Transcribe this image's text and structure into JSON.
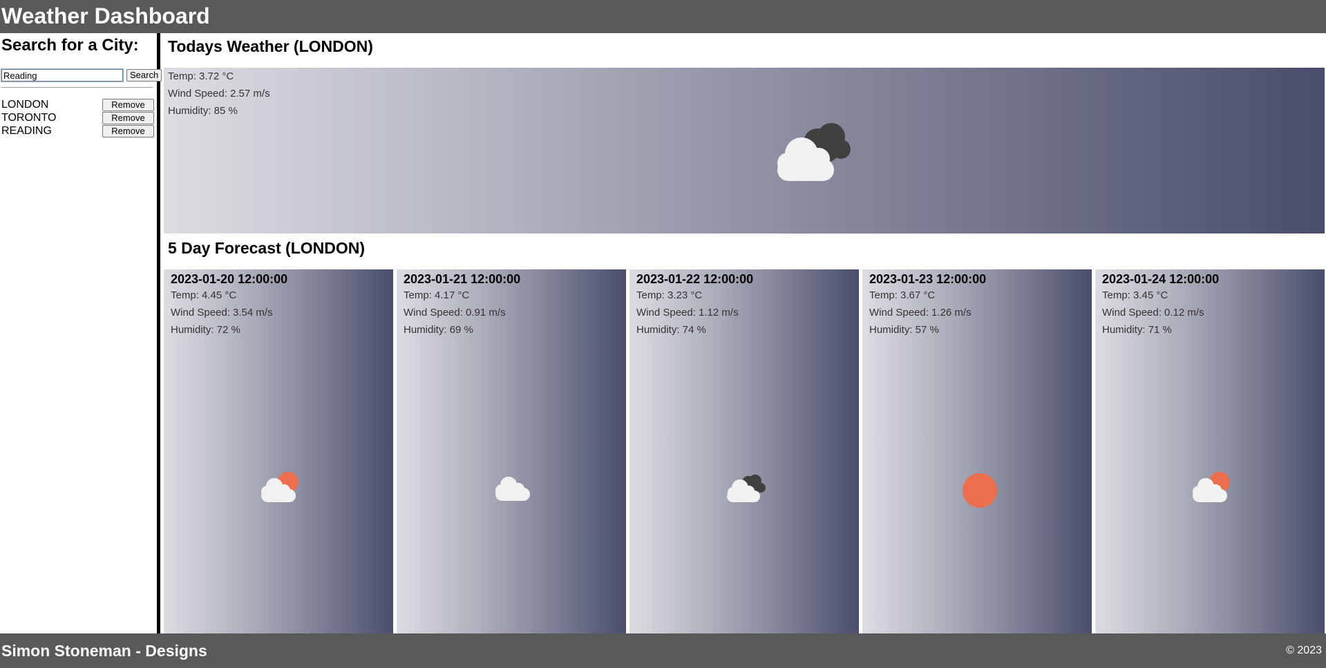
{
  "header": {
    "title": "Weather Dashboard"
  },
  "sidebar": {
    "heading": "Search for a City:",
    "search_value": "Reading",
    "search_button": "Search",
    "cities": [
      {
        "name": "LONDON",
        "remove_label": "Remove"
      },
      {
        "name": "TORONTO",
        "remove_label": "Remove"
      },
      {
        "name": "READING",
        "remove_label": "Remove"
      }
    ]
  },
  "today": {
    "title": "Todays Weather (LONDON)",
    "temp": "Temp: 3.72 °C",
    "wind": "Wind Speed: 2.57 m/s",
    "humidity": "Humidity: 85 %",
    "icon": "broken-clouds-icon"
  },
  "forecast": {
    "title": "5 Day Forecast (LONDON)",
    "days": [
      {
        "date": "2023-01-20 12:00:00",
        "temp": "Temp: 4.45 °C",
        "wind": "Wind Speed: 3.54 m/s",
        "humidity": "Humidity: 72 %",
        "icon": "partly-cloudy-icon"
      },
      {
        "date": "2023-01-21 12:00:00",
        "temp": "Temp: 4.17 °C",
        "wind": "Wind Speed: 0.91 m/s",
        "humidity": "Humidity: 69 %",
        "icon": "cloud-icon"
      },
      {
        "date": "2023-01-22 12:00:00",
        "temp": "Temp: 3.23 °C",
        "wind": "Wind Speed: 1.12 m/s",
        "humidity": "Humidity: 74 %",
        "icon": "broken-clouds-icon"
      },
      {
        "date": "2023-01-23 12:00:00",
        "temp": "Temp: 3.67 °C",
        "wind": "Wind Speed: 1.26 m/s",
        "humidity": "Humidity: 57 %",
        "icon": "sun-icon"
      },
      {
        "date": "2023-01-24 12:00:00",
        "temp": "Temp: 3.45 °C",
        "wind": "Wind Speed: 0.12 m/s",
        "humidity": "Humidity: 71 %",
        "icon": "partly-cloudy-icon"
      }
    ]
  },
  "footer": {
    "brand": "Simon Stoneman - Designs",
    "copyright": "© 2023"
  },
  "colors": {
    "header_bg": "#595959",
    "sun": "#ec6e4c",
    "cloud_light": "#f1f1f1",
    "cloud_dark": "#404040"
  }
}
